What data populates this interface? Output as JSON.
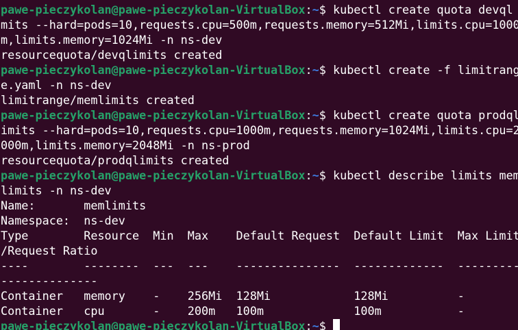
{
  "colors": {
    "background": "#300a24",
    "prompt_user": "#26a269",
    "prompt_path": "#3e7be0",
    "text": "#ffffff"
  },
  "prompt": {
    "user_host": "pawe-pieczykolan@pawe-pieczykolan-VirtualBox",
    "sep": ":",
    "path": "~",
    "suffix": "$ "
  },
  "commands": [
    {
      "first": "kubectl create quota devql",
      "cont": [
        "mits --hard=pods=10,requests.cpu=500m,requests.memory=512Mi,limits.cpu=1000",
        "m,limits.memory=1024Mi -n ns-dev"
      ],
      "output": [
        "resourcequota/devqlimits created"
      ]
    },
    {
      "first": "kubectl create -f limitrang",
      "cont": [
        "e.yaml -n ns-dev"
      ],
      "output": [
        "limitrange/memlimits created"
      ]
    },
    {
      "first": "kubectl create quota prodql",
      "cont": [
        "imits --hard=pods=10,requests.cpu=1000m,requests.memory=1024Mi,limits.cpu=2",
        "000m,limits.memory=2048Mi -n ns-prod"
      ],
      "output": [
        "resourcequota/prodqlimits created"
      ]
    },
    {
      "first": "kubectl describe limits mem",
      "cont": [
        "limits -n ns-dev"
      ],
      "output": [
        "Name:       memlimits",
        "Namespace:  ns-dev",
        "Type        Resource  Min  Max    Default Request  Default Limit  Max Limit",
        "/Request Ratio",
        "----        --------  ---  ---    ---------------  -------------  ---------",
        "--------------",
        "Container   memory    -    256Mi  128Mi            128Mi          -",
        "Container   cpu       -    200m   100m             100m           -"
      ]
    }
  ]
}
